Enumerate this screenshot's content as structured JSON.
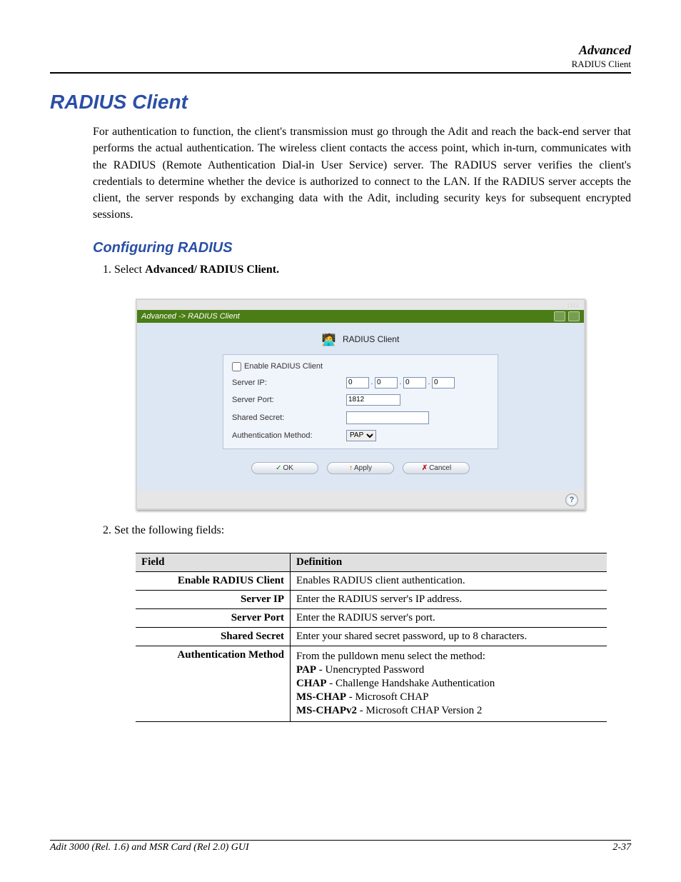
{
  "top": {
    "section": "Advanced",
    "subsection": "RADIUS Client"
  },
  "h1": "RADIUS Client",
  "intro": "For authentication to function, the client's transmission must go through the Adit and reach the back-end server that performs the actual authentication. The wireless client contacts the access point, which in-turn, communicates with the RADIUS (Remote Authentication Dial-in User Service) server. The RADIUS server verifies the client's credentials to determine whether the device is authorized to connect to the LAN. If the RADIUS server accepts the client, the server responds by exchanging data with the Adit, including security keys for subsequent encrypted sessions.",
  "h2": "Configuring RADIUS",
  "step1_prefix": "Select ",
  "step1_bold": "Advanced/ RADIUS Client.",
  "step2": "Set the following fields:",
  "shot": {
    "breadcrumb": "Advanced -> RADIUS Client",
    "title": "RADIUS Client",
    "enable_label": "Enable RADIUS Client",
    "server_ip_label": "Server IP:",
    "ip": [
      "0",
      "0",
      "0",
      "0"
    ],
    "server_port_label": "Server Port:",
    "server_port_value": "1812",
    "shared_secret_label": "Shared Secret:",
    "shared_secret_value": "",
    "auth_method_label": "Authentication Method:",
    "auth_method_value": "PAP",
    "btn_ok": "OK",
    "btn_apply": "Apply",
    "btn_cancel": "Cancel",
    "help": "?"
  },
  "table": {
    "h_field": "Field",
    "h_def": "Definition",
    "rows": [
      {
        "field": "Enable RADIUS Client",
        "def": "Enables RADIUS client authentication."
      },
      {
        "field": "Server IP",
        "def": "Enter the RADIUS server's IP address."
      },
      {
        "field": "Server Port",
        "def": "Enter the RADIUS server's port."
      },
      {
        "field": "Shared Secret",
        "def": "Enter your shared secret password, up to 8 characters."
      }
    ],
    "auth": {
      "field": "Authentication Method",
      "intro": "From the pulldown menu select the method:",
      "pap_b": "PAP",
      "pap_t": " - Unencrypted Password",
      "chap_b": "CHAP",
      "chap_t": " - Challenge Handshake Authentication",
      "ms_b": "MS-CHAP",
      "ms_t": " - Microsoft CHAP",
      "ms2_b": "MS-CHAPv2",
      "ms2_t": " - Microsoft CHAP Version 2"
    }
  },
  "footer": {
    "left": "Adit 3000 (Rel. 1.6) and MSR Card (Rel 2.0) GUI",
    "right": "2-37"
  }
}
